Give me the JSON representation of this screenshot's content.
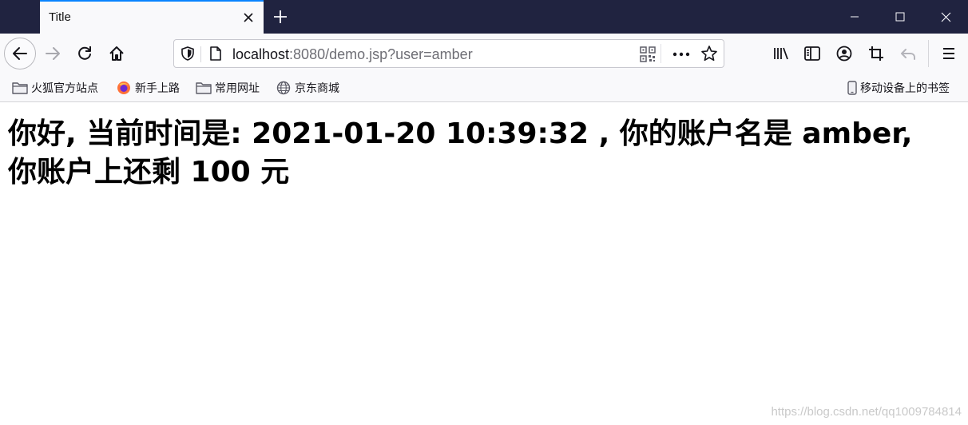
{
  "tab": {
    "title": "Title"
  },
  "urlbar": {
    "host": "localhost",
    "rest": ":8080/demo.jsp?user=amber"
  },
  "bookmarks": [
    {
      "label": "火狐官方站点",
      "icon": "folder-icon"
    },
    {
      "label": "新手上路",
      "icon": "firefox-icon"
    },
    {
      "label": "常用网址",
      "icon": "folder-icon"
    },
    {
      "label": "京东商城",
      "icon": "globe-icon"
    }
  ],
  "mobile_bookmarks": {
    "label": "移动设备上的书签",
    "icon": "mobile-icon"
  },
  "page": {
    "line1": "你好, 当前时间是: 2021-01-20 10:39:32 , 你的账户名是 amber,",
    "line2": "你账户上还剩 100 元"
  },
  "watermark": "https://blog.csdn.net/qq1009784814"
}
